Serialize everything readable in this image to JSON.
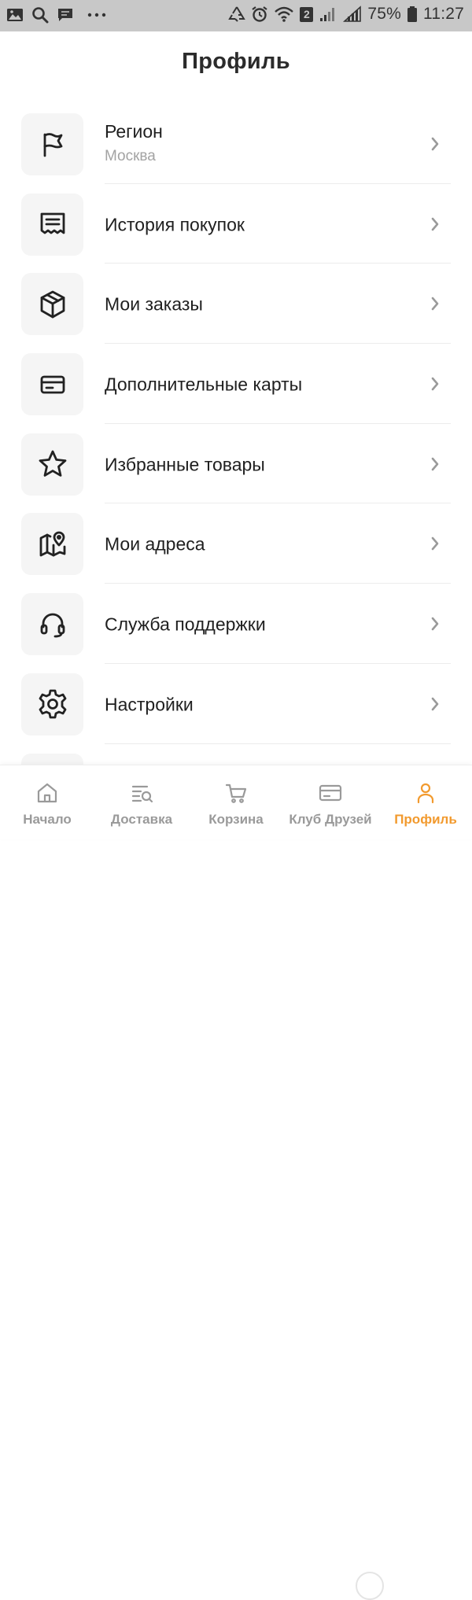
{
  "status_bar": {
    "sim_slot": "2",
    "battery": "75%",
    "time": "11:27",
    "icons": [
      "image-icon",
      "search-icon",
      "message-icon",
      "more-icon",
      "recycle-icon",
      "alarm-icon",
      "wifi-icon",
      "signal-icon",
      "signal-icon-2",
      "battery-icon"
    ]
  },
  "header": {
    "title": "Профиль"
  },
  "menu": {
    "items": [
      {
        "label": "Регион",
        "sublabel": "Москва",
        "icon": "flag-icon"
      },
      {
        "label": "История покупок",
        "icon": "receipt-icon"
      },
      {
        "label": "Мои заказы",
        "icon": "box-icon"
      },
      {
        "label": "Дополнительные карты",
        "icon": "card-icon"
      },
      {
        "label": "Избранные товары",
        "icon": "star-icon"
      },
      {
        "label": "Мои адреса",
        "icon": "map-pin-icon"
      },
      {
        "label": "Служба поддержки",
        "icon": "headset-icon"
      },
      {
        "label": "Настройки",
        "icon": "gear-icon"
      }
    ]
  },
  "bottom_nav": {
    "items": [
      {
        "label": "Начало",
        "icon": "home-icon",
        "active": false
      },
      {
        "label": "Доставка",
        "icon": "delivery-search-icon",
        "active": false
      },
      {
        "label": "Корзина",
        "icon": "cart-icon",
        "active": false
      },
      {
        "label": "Клуб Друзей",
        "icon": "card-icon",
        "active": false
      },
      {
        "label": "Профиль",
        "icon": "user-icon",
        "active": true
      }
    ]
  },
  "colors": {
    "accent": "#f29a2e",
    "icon_bg": "#f5f5f5",
    "text_primary": "#1f1f1f",
    "text_secondary": "#a3a3a3",
    "nav_inactive": "#9a9a9a",
    "status_bar_bg": "#c8c8c8"
  }
}
